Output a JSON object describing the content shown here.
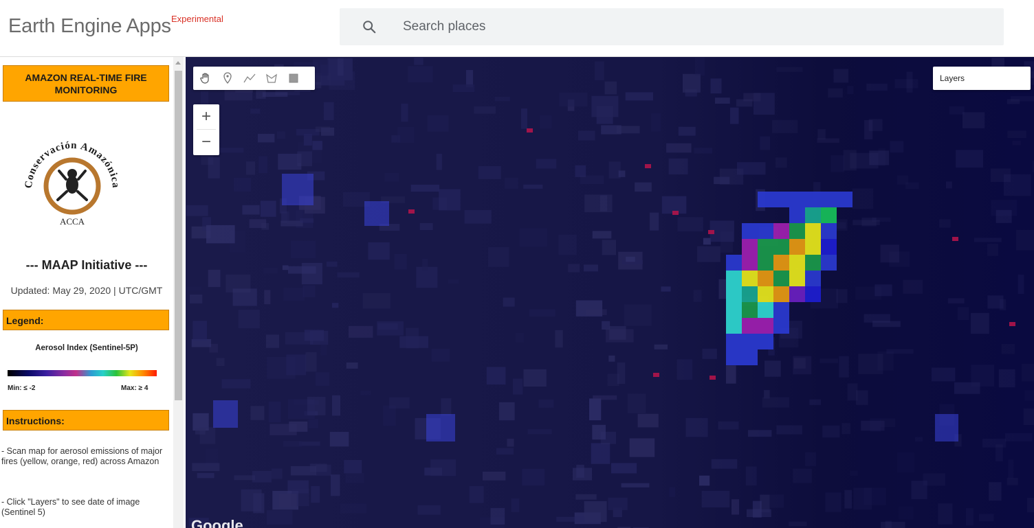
{
  "header": {
    "app_title": "Earth Engine Apps",
    "badge": "Experimental",
    "search_placeholder": "Search places",
    "search_value": ""
  },
  "sidebar": {
    "title": "AMAZON REAL-TIME FIRE MONITORING",
    "logo": {
      "arc_text": "Conservación Amazónica",
      "acronym": "ACCA"
    },
    "initiative": "--- MAAP Initiative ---",
    "updated": "Updated: May 29, 2020 | UTC/GMT",
    "legend": {
      "header": "Legend:",
      "title": "Aerosol Index (Sentinel-5P)",
      "min_label": "Min: ≤ -2",
      "max_label": "Max: ≥ 4"
    },
    "instructions": {
      "header": "Instructions:",
      "items": [
        "- Scan map for aerosol emissions of major fires (yellow, orange, red) across Amazon",
        "- Click \"Layers\" to see date of image (Sentinel 5)"
      ]
    }
  },
  "map": {
    "tools": [
      "hand-icon",
      "marker-icon",
      "polyline-icon",
      "polygon-icon",
      "rectangle-icon"
    ],
    "zoom_in": "+",
    "zoom_out": "−",
    "layers_label": "Layers",
    "attribution": "Google"
  },
  "colors": {
    "accent_orange": "#ffa500",
    "experimental_red": "#d93025",
    "map_base": "#0c0c3a"
  }
}
